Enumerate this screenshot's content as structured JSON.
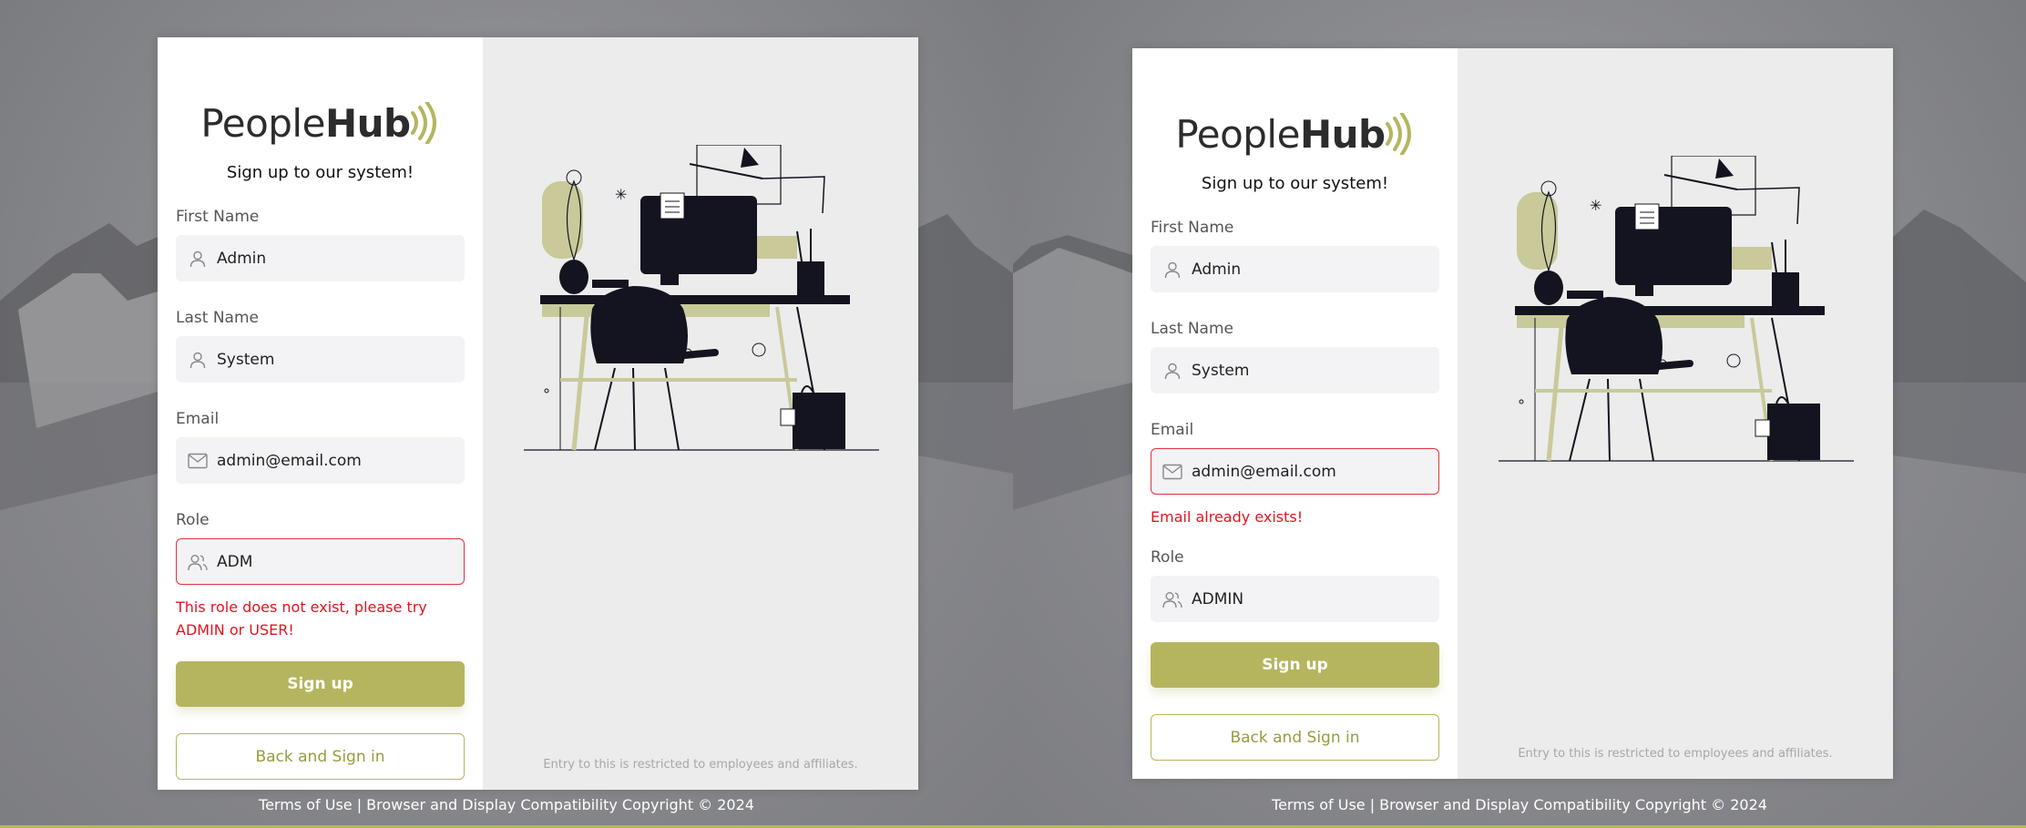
{
  "screens": [
    {
      "logo": {
        "text_light": "People",
        "text_bold": "Hub"
      },
      "subtitle": "Sign up to our system!",
      "fields": {
        "first_name": {
          "label": "First Name",
          "value": "Admin",
          "icon": "user-icon"
        },
        "last_name": {
          "label": "Last Name",
          "value": "System",
          "icon": "user-icon"
        },
        "email": {
          "label": "Email",
          "value": "admin@email.com",
          "icon": "mail-icon"
        },
        "role": {
          "label": "Role",
          "value": "ADM",
          "icon": "users-icon",
          "error": "This role does not exist, please try ADMIN or USER!"
        }
      },
      "signup_label": "Sign up",
      "back_label": "Back and Sign in",
      "restricted_note": "Entry to this is restricted to employees and affiliates.",
      "footer": "Terms of Use | Browser and Display Compatibility Copyright © 2024"
    },
    {
      "logo": {
        "text_light": "People",
        "text_bold": "Hub"
      },
      "subtitle": "Sign up to our system!",
      "fields": {
        "first_name": {
          "label": "First Name",
          "value": "Admin",
          "icon": "user-icon"
        },
        "last_name": {
          "label": "Last Name",
          "value": "System",
          "icon": "user-icon"
        },
        "email": {
          "label": "Email",
          "value": "admin@email.com",
          "icon": "mail-icon",
          "error": "Email already exists!"
        },
        "role": {
          "label": "Role",
          "value": "ADMIN",
          "icon": "users-icon"
        }
      },
      "signup_label": "Sign up",
      "back_label": "Back and Sign in",
      "restricted_note": "Entry to this is restricted to employees and affiliates.",
      "footer": "Terms of Use | Browser and Display Compatibility Copyright © 2024"
    }
  ],
  "colors": {
    "accent": "#b5b560",
    "error": "#e0151f",
    "illustration_dark": "#13141f",
    "illustration_olive": "#c9c99a"
  }
}
